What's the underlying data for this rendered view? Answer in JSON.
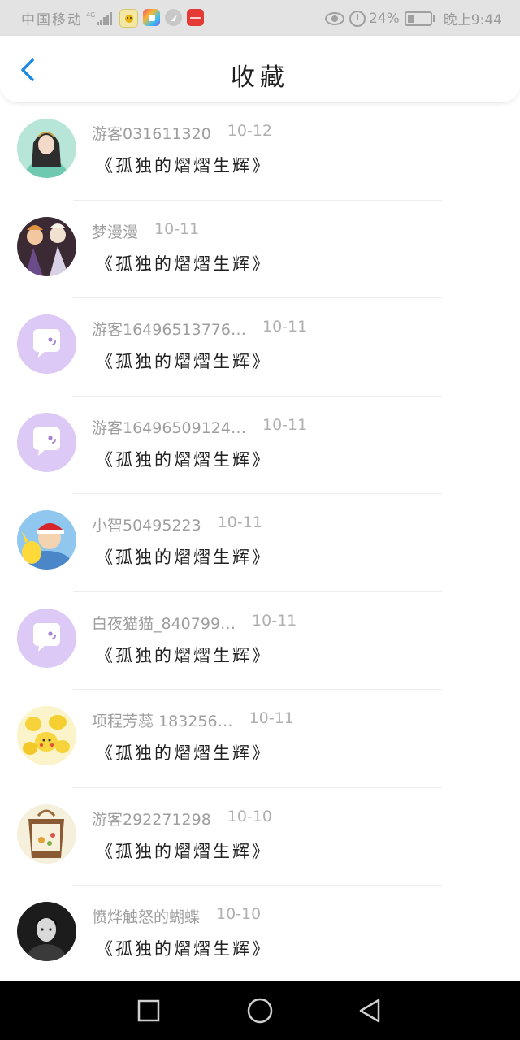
{
  "status_bar": {
    "carrier": "中国移动",
    "network": "4G",
    "battery": "24%",
    "time": "晚上9:44",
    "app_icons": [
      "qq-browser-icon",
      "color-app-icon",
      "feather-app-icon",
      "huawei-app-icon"
    ]
  },
  "header": {
    "title": "收藏",
    "back_icon": "chevron-left-icon"
  },
  "items": [
    {
      "user": "游客031611320",
      "date": "10-12",
      "title": "《孤独的熠熠生辉》",
      "avatar": "girl-portrait"
    },
    {
      "user": "梦漫漫",
      "date": "10-11",
      "title": "《孤独的熠熠生辉》",
      "avatar": "anime-characters"
    },
    {
      "user": "游客16496513776…",
      "date": "10-11",
      "title": "《孤独的熠熠生辉》",
      "avatar": "default-chat-bubble"
    },
    {
      "user": "游客16496509124…",
      "date": "10-11",
      "title": "《孤独的熠熠生辉》",
      "avatar": "default-chat-bubble"
    },
    {
      "user": "小智50495223",
      "date": "10-11",
      "title": "《孤独的熠熠生辉》",
      "avatar": "pokemon-ash"
    },
    {
      "user": "白夜猫猫_840799…",
      "date": "10-11",
      "title": "《孤独的熠熠生辉》",
      "avatar": "default-chat-bubble"
    },
    {
      "user": "项程芳蕊 183256…",
      "date": "10-11",
      "title": "《孤独的熠熠生辉》",
      "avatar": "pikachu-cluster"
    },
    {
      "user": "游客292271298",
      "date": "10-10",
      "title": "《孤独的熠熠生辉》",
      "avatar": "tote-bag"
    },
    {
      "user": "愤烨触怒的蝴蝶",
      "date": "10-10",
      "title": "《孤独的熠熠生辉》",
      "avatar": "dark-portrait"
    }
  ],
  "nav_bar": {
    "recent": "square-icon",
    "home": "circle-icon",
    "back": "triangle-back-icon"
  },
  "colors": {
    "accent": "#1e88e5",
    "default_avatar_bg": "#ddc9f5",
    "status_bar_bg": "#e3e3e3"
  }
}
